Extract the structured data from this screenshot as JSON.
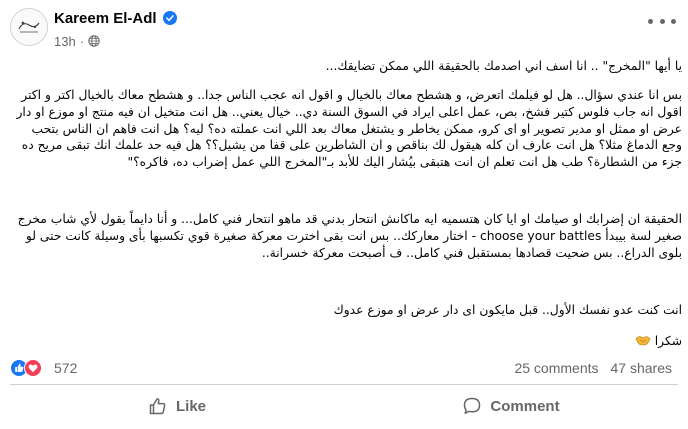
{
  "author": {
    "name": "Kareem El-Adl",
    "verified": true
  },
  "post": {
    "time": "13h",
    "separator": "·",
    "audience_icon": "globe-icon",
    "paragraphs": [
      "يا أيها \"المخرج\" .. انا اسف اني اصدمك بالحقيقة اللي ممكن تضايقك...",
      "بس انا عندي سؤال.. هل لو فيلمك اتعرض، و هشطح معاك بالخيال و اقول انه عجب الناس جدا.. و هشطح معاك بالخيال اكتر و اكتر اقول انه جاب فلوس كتير فشخ، بص، عمل اعلى ايراد في السوق السنة دي.. خيال يعني.. هل انت متخيل ان فيه منتج او موزع او دار عرض او ممثل او مدير تصوير او اى كرو، ممكن يخاطر و يشتغل معاك بعد اللي انت عملته ده؟ ليه؟ هل انت فاهم ان الناس بتحب وجع الدماغ مثلا؟ هل انت عارف ان كله هيقول لك بناقص و ان الشاطرين على قفا من يشيل؟؟ هل فيه حد علمك انك تبقى مريح ده جزء من الشطارة؟ طب هل انت تعلم ان انت هتبقى بيُشار اليك للأبد بـ\"المخرج اللي عمل إضراب ده، فاكره؟\"",
      "الحقيقة ان إضرابك او صيامك او ايا كان هتسميه ايه ماكانش انتحار بدني قد ماهو انتحار فني كامل... و أنا دايماً بقول لأي شاب مخرج صغير لسة بيبدأ choose your battles - اختار معاركك.. بس انت بقى اخترت معركة صغيرة قوي تكسبها بأى وسيلة كانت حتى لو بلوى الدراع.. بس ضحيت قصادها بمستقبل فني كامل.. ف أصبحت معركة خسرانة..",
      "انت كنت عدو نفسك الأول.. قبل مايكون اى دار عرض او موزع عدوك",
      "شكرا"
    ]
  },
  "reactions": {
    "count": "572",
    "types": [
      "like",
      "love"
    ]
  },
  "stats": {
    "comments": "25 comments",
    "shares": "47 shares"
  },
  "actions": {
    "like": "Like",
    "comment": "Comment"
  },
  "colors": {
    "verified_blue": "#1877f2",
    "secondary_text": "#65676b",
    "like_blue": "#1877f2",
    "love_red": "#f33e58"
  }
}
